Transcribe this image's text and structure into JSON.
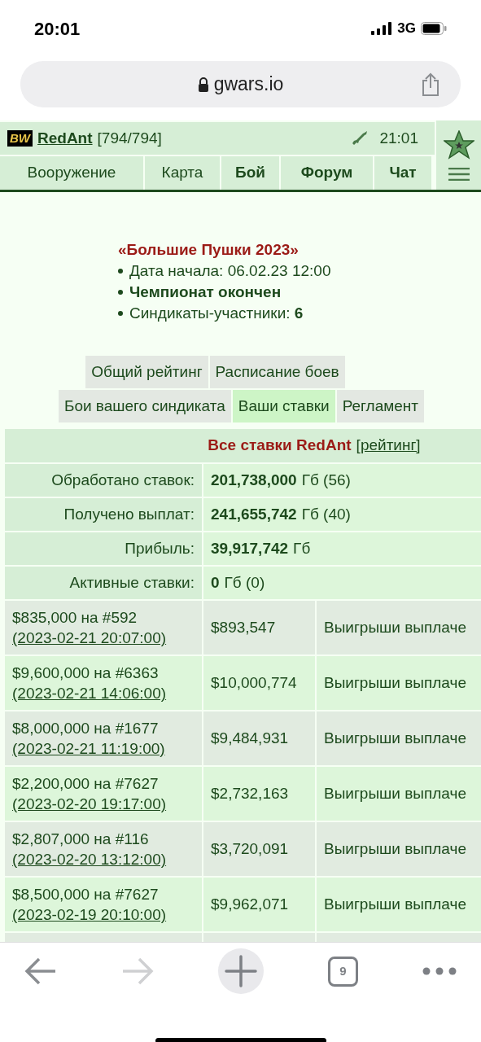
{
  "status_bar": {
    "time": "20:01",
    "network": "3G"
  },
  "browser": {
    "url": "gwars.io"
  },
  "header": {
    "logo": "BW",
    "user": "RedAnt",
    "hp": "[794/794]",
    "time": "21:01"
  },
  "nav": [
    {
      "label": "Вооружение",
      "bold": false
    },
    {
      "label": "Карта",
      "bold": false
    },
    {
      "label": "Бой",
      "bold": true
    },
    {
      "label": "Форум",
      "bold": true
    },
    {
      "label": "Чат",
      "bold": true
    }
  ],
  "event": {
    "title": "«Большие Пушки 2023»",
    "lines": [
      "Дата начала: 06.02.23 12:00",
      "**Чемпионат окончен**",
      "Синдикаты-участники: **6**"
    ]
  },
  "tabs": [
    [
      {
        "label": "Общий рейтинг",
        "selected": false
      },
      {
        "label": "Расписание боев",
        "selected": false
      }
    ],
    [
      {
        "label": "Бои вашего синдиката",
        "selected": false
      },
      {
        "label": "Ваши ставки",
        "selected": true
      },
      {
        "label": "Регламент",
        "selected": false
      }
    ]
  ],
  "bets": {
    "title": "Все ставки RedAnt",
    "link": "[рейтинг]",
    "summary": [
      {
        "label": "Обработано ставок:",
        "amount": "201,738,000",
        "unit": "Гб (56)"
      },
      {
        "label": "Получено выплат:",
        "amount": "241,655,742",
        "unit": "Гб (40)"
      },
      {
        "label": "Прибыль:",
        "amount": "39,917,742",
        "unit": "Гб"
      },
      {
        "label": "Активные ставки:",
        "amount": "0",
        "unit": "Гб (0)"
      }
    ],
    "rows": [
      {
        "bet": "$835,000 на #592",
        "date": "(2023-02-21 20:07:00)",
        "payout": "$893,547",
        "status": "Выигрыши выплаче"
      },
      {
        "bet": "$9,600,000 на #6363",
        "date": "(2023-02-21 14:06:00)",
        "payout": "$10,000,774",
        "status": "Выигрыши выплаче"
      },
      {
        "bet": "$8,000,000 на #1677",
        "date": "(2023-02-21 11:19:00)",
        "payout": "$9,484,931",
        "status": "Выигрыши выплаче"
      },
      {
        "bet": "$2,200,000 на #7627",
        "date": "(2023-02-20 19:17:00)",
        "payout": "$2,732,163",
        "status": "Выигрыши выплаче"
      },
      {
        "bet": "$2,807,000 на #116",
        "date": "(2023-02-20 13:12:00)",
        "payout": "$3,720,091",
        "status": "Выигрыши выплаче"
      },
      {
        "bet": "$8,500,000 на #7627",
        "date": "(2023-02-19 20:10:00)",
        "payout": "$9,962,071",
        "status": "Выигрыши выплаче"
      }
    ]
  },
  "toolbar": {
    "tabs_count": "9"
  }
}
